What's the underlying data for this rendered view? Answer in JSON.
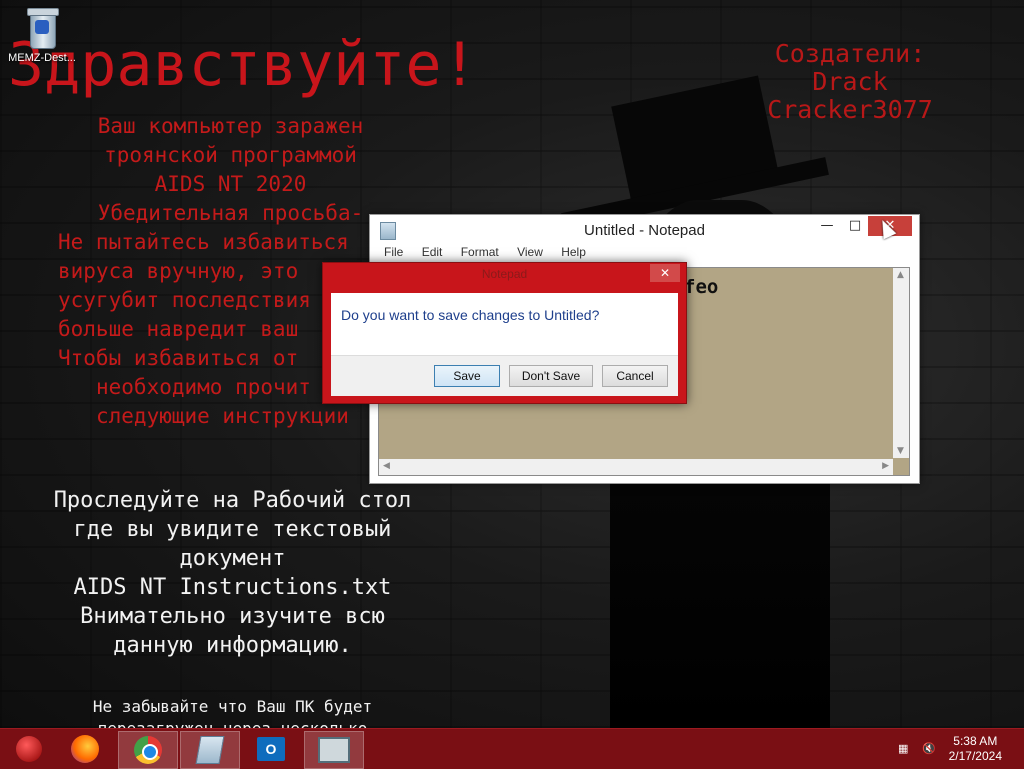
{
  "desktop": {
    "icon_label": "MEMZ-Dest...",
    "greeting": "Здравствуйте!",
    "creators": [
      "Создатели:",
      "Drack",
      "Cracker3077"
    ],
    "red_lines": [
      "Ваш компьютер заражен",
      "троянской программой",
      "AIDS NT 2020",
      "Убедительная просьба-",
      "Не пытайтесь избавиться",
      "вируса вручную, это",
      "усугубит последствия",
      "больше навредит ваш",
      "Чтобы избавиться от",
      "необходимо прочит",
      "следующие инструкции"
    ],
    "white_lines": [
      "Проследуйте на Рабочий стол",
      "где вы увидите текстовый",
      "документ",
      "AIDS NT Instructions.txt",
      "Внимательно изучите всю",
      "данную информацию."
    ],
    "footer_lines": [
      "Не забывайте что Ваш ПК будет",
      "перезагружен через несколько"
    ]
  },
  "notepad": {
    "title": "Untitled - Notepad",
    "menu": [
      "File",
      "Edit",
      "Format",
      "View",
      "Help"
    ],
    "content": "feo",
    "colors": {
      "edit_bg": "#b2a585"
    }
  },
  "dialog": {
    "title": "Notepad",
    "message": "Do you want to save changes to Untitled?",
    "buttons": {
      "save": "Save",
      "dont_save": "Don't Save",
      "cancel": "Cancel"
    },
    "colors": {
      "frame": "#c8151b"
    }
  },
  "taskbar": {
    "items": [
      "start-orb-icon",
      "firefox-icon",
      "chrome-icon",
      "notepad-icon",
      "outlook-icon",
      "remote-desktop-icon"
    ],
    "outlook_letter": "O",
    "time": "5:38 AM",
    "date": "2/17/2024",
    "colors": {
      "bar": "#7a0f14"
    }
  }
}
